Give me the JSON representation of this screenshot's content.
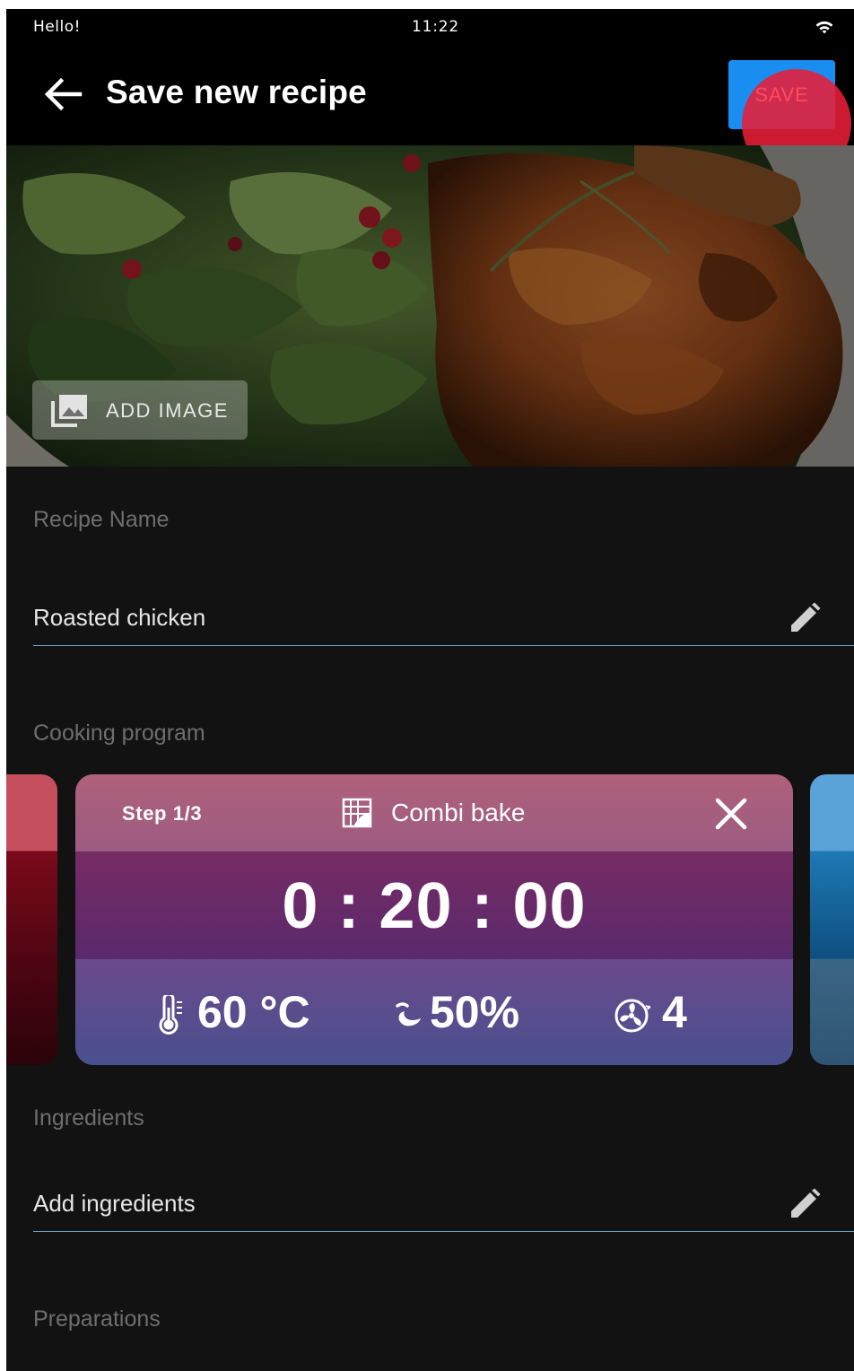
{
  "status_bar": {
    "greeting": "Hello!",
    "time": "11:22",
    "icons": [
      "wifi-icon"
    ]
  },
  "app_bar": {
    "back_icon": "arrow-left-icon",
    "title": "Save new recipe",
    "save_label": "SAVE"
  },
  "hero": {
    "add_image_label": "ADD IMAGE",
    "add_image_icon": "image-gallery-icon"
  },
  "recipe_name": {
    "label": "Recipe Name",
    "value": "Roasted chicken",
    "edit_icon": "pencil-icon"
  },
  "cooking_program": {
    "label": "Cooking program",
    "current_step": {
      "step": "Step 1/3",
      "mode_icon": "combi-bake-icon",
      "mode": "Combi bake",
      "close_icon": "close-icon",
      "duration": "0 : 20 : 00",
      "temperature": "60 °C",
      "temperature_icon": "thermometer-icon",
      "humidity": "50%",
      "humidity_icon": "steam-icon",
      "fan_level": "4",
      "fan_icon": "fan-icon"
    }
  },
  "ingredients": {
    "label": "Ingredients",
    "value": "Add ingredients",
    "edit_icon": "pencil-icon"
  },
  "preparations": {
    "label": "Preparations"
  },
  "colors": {
    "background": "#121212",
    "app_bar": "#000000",
    "save_button": "#1a8ef0",
    "touch_ripple": "#e81e38",
    "field_underline": "#6aa6cc"
  }
}
